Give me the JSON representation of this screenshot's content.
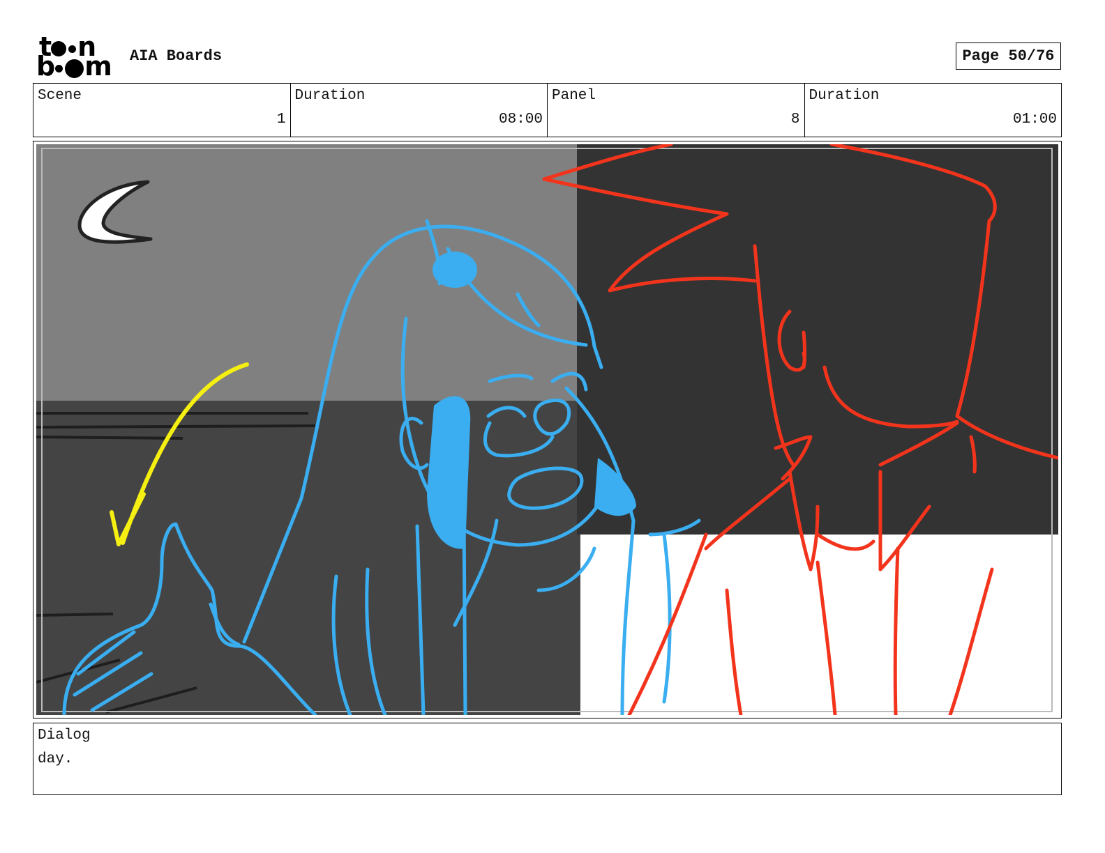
{
  "header": {
    "logo_text": "toon boom",
    "app_title": "AIA Boards",
    "page_indicator": "Page 50/76"
  },
  "info": {
    "scene_label": "Scene",
    "scene_value": "1",
    "scene_duration_label": "Duration",
    "scene_duration_value": "08:00",
    "panel_label": "Panel",
    "panel_value": "8",
    "panel_duration_label": "Duration",
    "panel_duration_value": "01:00"
  },
  "dialog": {
    "label": "Dialog",
    "text": "day."
  },
  "colors": {
    "female_character": "#3aaef0",
    "male_character": "#f3341c",
    "motion_arrow": "#f5ef12",
    "sky": "#808080",
    "ground": "#444444",
    "night_window": "#333333"
  }
}
